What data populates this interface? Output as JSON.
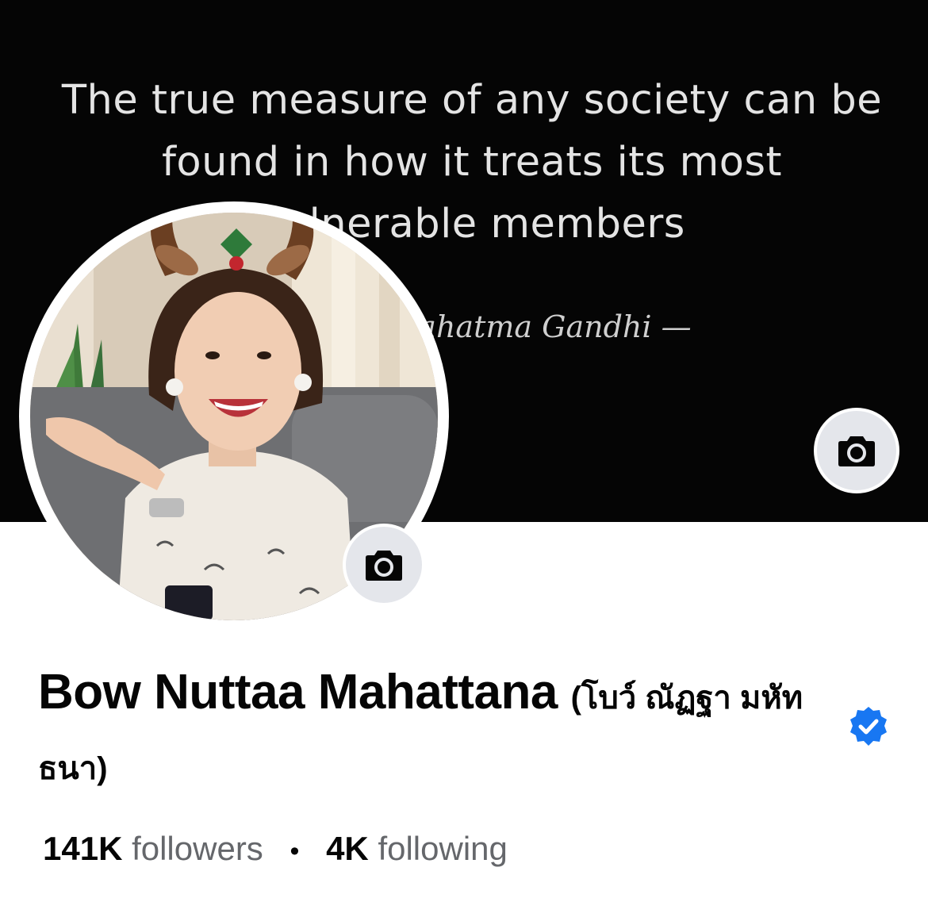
{
  "cover": {
    "quote": "The true measure of any society can be found in how it treats its most vulnerable members",
    "author": "Mahatma Gandhi —",
    "camera_icon": "camera-icon"
  },
  "profile": {
    "avatar_camera_icon": "camera-icon",
    "name": "Bow Nuttaa Mahattana",
    "alt_name": "(โบว์ ณัฏฐา มหัทธนา)",
    "verified": true,
    "verified_icon": "verified-badge-icon",
    "followers_count": "141K",
    "followers_label": "followers",
    "separator": "•",
    "following_count": "4K",
    "following_label": "following"
  },
  "colors": {
    "cover_background": "#050505",
    "button_background": "#e4e6eb",
    "verified_blue": "#1877f2",
    "secondary_text": "#65676b"
  }
}
